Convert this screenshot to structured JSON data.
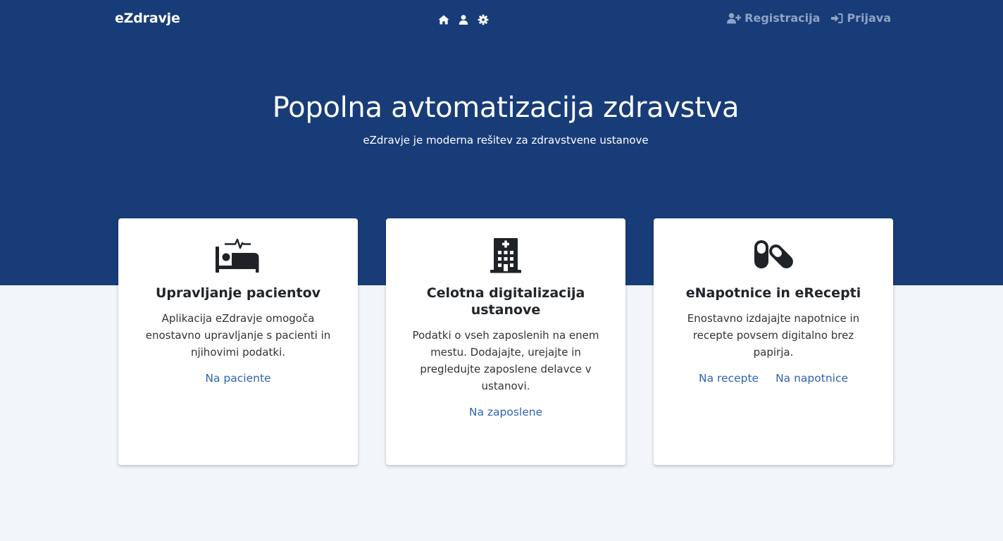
{
  "nav": {
    "brand": "eZdravje",
    "icons": [
      "home-icon",
      "user-icon",
      "gear-icon"
    ],
    "register_label": "Registracija",
    "login_label": "Prijava"
  },
  "hero": {
    "title": "Popolna avtomatizacija zdravstva",
    "subtitle": "eZdravje je moderna rešitev za zdravstvene ustanove"
  },
  "cards": [
    {
      "icon": "procedures-bed-icon",
      "title": "Upravljanje pacientov",
      "text": "Aplikacija eZdravje omogoča enostavno upravljanje s pacienti in njihovimi podatki.",
      "links": [
        "Na paciente"
      ]
    },
    {
      "icon": "hospital-icon",
      "title": "Celotna digitalizacija ustanove",
      "text": "Podatki o vseh zaposlenih na enem mestu. Dodajajte, urejajte in pregledujte zaposlene delavce v ustanovi.",
      "links": [
        "Na zaposlene"
      ]
    },
    {
      "icon": "capsules-icon",
      "title": "eNapotnice in eRecepti",
      "text": "Enostavno izdajajte napotnice in recepte povsem digitalno brez papirja.",
      "links": [
        "Na recepte",
        "Na napotnice"
      ]
    }
  ],
  "colors": {
    "primary": "#183c78",
    "background": "#f2f5fa",
    "link": "#2e63b5",
    "nav_muted": "#8ea3c5"
  }
}
